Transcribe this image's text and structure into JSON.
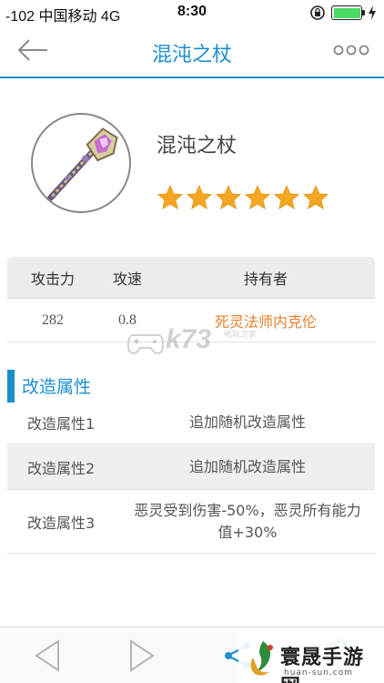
{
  "status_bar": {
    "carrier": "-102 中国移动  4G",
    "time": "8:30"
  },
  "nav": {
    "title": "混沌之杖"
  },
  "item": {
    "name": "混沌之杖",
    "rating": 6,
    "rating_max": 6
  },
  "stats": {
    "headers": [
      "攻击力",
      "攻速",
      "持有者"
    ],
    "row": {
      "attack": "282",
      "speed": "0.8",
      "owner": "死灵法师内克伦"
    },
    "owner_color": "#e8802c"
  },
  "watermark": {
    "text": "k73",
    "sub": "电玩之家"
  },
  "section": {
    "title": "改造属性"
  },
  "properties": [
    {
      "name": "改造属性1",
      "value": "追加随机改造属性"
    },
    {
      "name": "改造属性2",
      "value": "追加随机改造属性"
    },
    {
      "name": "改造属性3",
      "value": "恶灵受到伤害-50%，恶灵所有能力值+30%"
    }
  ],
  "brand": {
    "name": "寰晟手游网",
    "url": "huan-sun.com"
  },
  "colors": {
    "accent": "#1d8fd0",
    "star": "#f5a623",
    "battery": "#4cd964"
  }
}
